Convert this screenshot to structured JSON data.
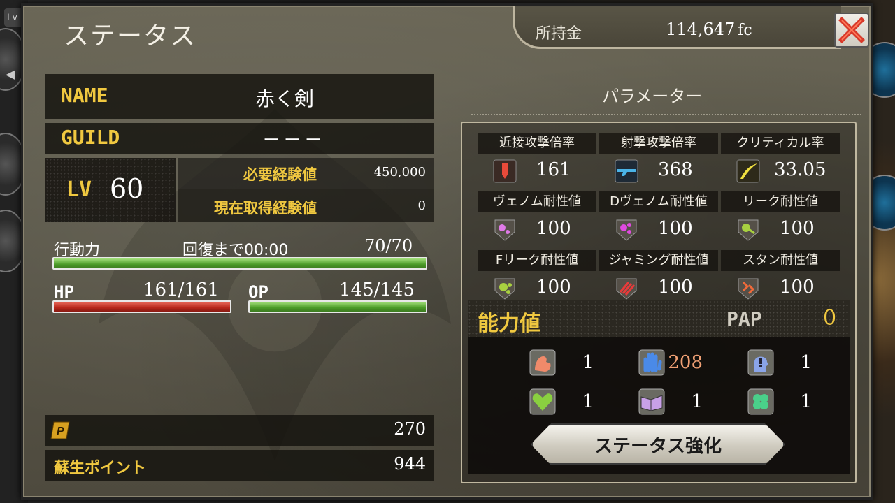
{
  "background": {
    "lv_badge": "Lv"
  },
  "header": {
    "title": "ステータス",
    "money_label": "所持金",
    "money_value": "114,647",
    "money_unit": "fc"
  },
  "profile": {
    "name_label": "NAME",
    "name_value": "赤く剣",
    "guild_label": "GUILD",
    "guild_value": "－－－",
    "lv_label": "LV",
    "lv_value": "60",
    "exp_required_label": "必要経験値",
    "exp_required_value": "450,000",
    "exp_current_label": "現在取得経験値",
    "exp_current_value": "0"
  },
  "stats": {
    "action_label": "行動力",
    "recovery_text": "回復まで00:00",
    "action_value": "70/70",
    "action_fill": 1.0,
    "hp_label": "HP",
    "hp_value": "161/161",
    "hp_fill": 1.0,
    "op_label": "OP",
    "op_value": "145/145",
    "op_fill": 1.0
  },
  "points": {
    "p_value": "270",
    "revive_label": "蘇生ポイント",
    "revive_value": "944"
  },
  "parameters": {
    "title": "パラメーター",
    "cells": [
      {
        "label": "近接攻撃倍率",
        "value": "161",
        "icon": "sword-icon"
      },
      {
        "label": "射撃攻撃倍率",
        "value": "368",
        "icon": "gun-icon"
      },
      {
        "label": "クリティカル率",
        "value": "33.05",
        "icon": "critical-icon"
      },
      {
        "label": "ヴェノム耐性値",
        "value": "100",
        "icon": "venom-icon"
      },
      {
        "label": "Dヴェノム耐性値",
        "value": "100",
        "icon": "d-venom-icon"
      },
      {
        "label": "リーク耐性値",
        "value": "100",
        "icon": "leak-icon"
      },
      {
        "label": "Fリーク耐性値",
        "value": "100",
        "icon": "f-leak-icon"
      },
      {
        "label": "ジャミング耐性値",
        "value": "100",
        "icon": "jamming-icon"
      },
      {
        "label": "スタン耐性値",
        "value": "100",
        "icon": "stun-icon"
      }
    ]
  },
  "ability": {
    "title": "能力値",
    "pap_label": "PAP",
    "pap_value": "0",
    "cells": [
      {
        "value": "1",
        "icon": "arm-icon"
      },
      {
        "value": "208",
        "icon": "hand-icon"
      },
      {
        "value": "1",
        "icon": "head-icon"
      },
      {
        "value": "1",
        "icon": "heart-icon"
      },
      {
        "value": "1",
        "icon": "book-icon"
      },
      {
        "value": "1",
        "icon": "clover-icon"
      }
    ],
    "button_label": "ステータス強化"
  }
}
